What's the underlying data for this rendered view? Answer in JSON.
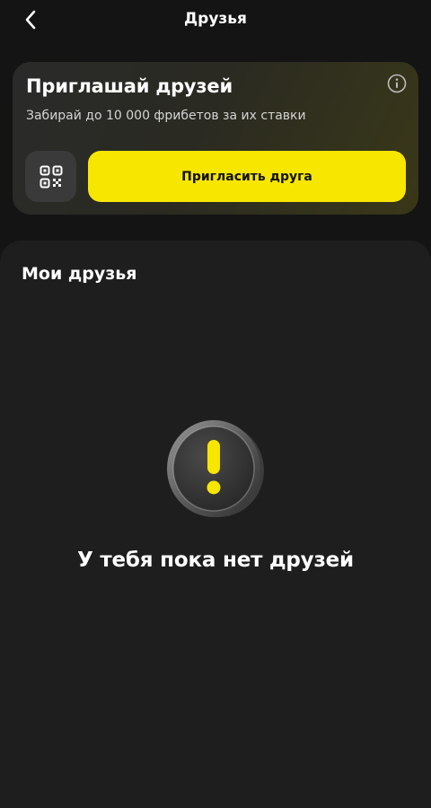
{
  "header": {
    "title": "Друзья",
    "back_icon": "chevron-left-icon"
  },
  "invite_card": {
    "title": "Приглашай друзей",
    "subtitle": "Забирай до 10 000 фрибетов за их ставки",
    "info_icon": "info-icon",
    "qr_icon": "qr-code-icon",
    "button_label": "Пригласить друга",
    "accent_color": "#f7e600"
  },
  "friends": {
    "title": "Мои друзья",
    "empty_icon": "exclamation-coin-icon",
    "empty_text": "У тебя пока нет друзей"
  }
}
